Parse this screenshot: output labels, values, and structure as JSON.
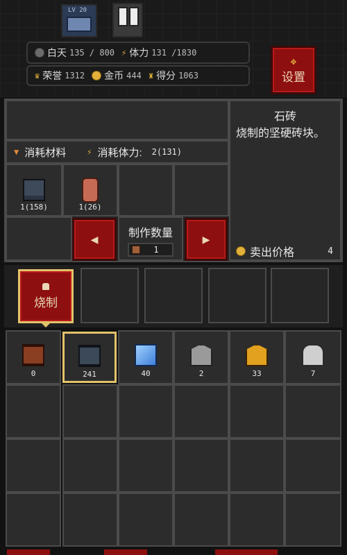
{
  "hud": {
    "day_label": "白天",
    "day_value": "135 / 800",
    "stamina_label": "体力",
    "stamina_value": "131 /1830",
    "honor_label": "荣誉",
    "honor_value": "1312",
    "gold_label": "金币",
    "gold_value": "444",
    "score_label": "得分",
    "score_value": "1063",
    "settings_label": "设置"
  },
  "scene": {
    "level_badge": "LV 20"
  },
  "craft": {
    "consume_materials_label": "消耗材料",
    "consume_stamina_label": "消耗体力:",
    "consume_stamina_value": "2(131)",
    "materials": [
      {
        "icon": "stone-block-icon",
        "count": "1(158)"
      },
      {
        "icon": "clay-cylinder-icon",
        "count": "1(26)"
      },
      {
        "icon": "",
        "count": ""
      },
      {
        "icon": "",
        "count": ""
      }
    ],
    "quantity_label": "制作数量",
    "quantity_value": "1",
    "left_arrow": "◀",
    "right_arrow": "▶"
  },
  "detail": {
    "title": "石砖",
    "description": "烧制的坚硬砖块。",
    "sell_label": "卖出价格",
    "sell_value": "4"
  },
  "tabs": {
    "active_label": "烧制"
  },
  "inventory": [
    {
      "icon": "red-brick-icon",
      "count": "0"
    },
    {
      "icon": "stone-brick-icon",
      "count": "241",
      "selected": true
    },
    {
      "icon": "glass-pane-icon",
      "count": "40"
    },
    {
      "icon": "iron-book-icon",
      "count": "2"
    },
    {
      "icon": "gold-book-icon",
      "count": "33"
    },
    {
      "icon": "silver-figure-icon",
      "count": "7"
    }
  ],
  "colors": {
    "accent_red": "#8e0f0f",
    "selected_border": "#e3c36a"
  }
}
